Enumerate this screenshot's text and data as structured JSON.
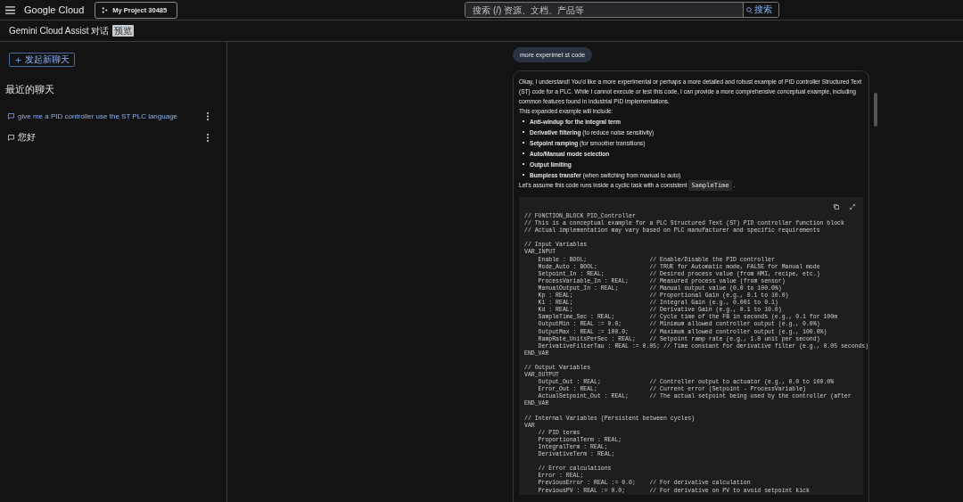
{
  "topbar": {
    "logo": "Google Cloud",
    "project": "My Project 30485",
    "search": {
      "placeholder": "搜索 (/) 资源、文档、产品等",
      "button": "搜索"
    }
  },
  "header": {
    "title": "Gemini Cloud Assist 对话",
    "badge": "预览"
  },
  "sidebar": {
    "new_chat": "发起新聊天",
    "heading": "最近的聊天",
    "chats": [
      {
        "label": "give me a PID controller use the ST PLC language",
        "selected": true
      },
      {
        "label": "您好",
        "selected": false
      }
    ]
  },
  "conversation": {
    "user_message": "more experimet st code",
    "response": {
      "intro": "Okay, I understand! You'd like a more experimental or perhaps a more detailed and robust example of PID controller Structured Text (ST) code for a PLC. While I cannot execute or test this code, I can provide a more comprehensive conceptual example, including common features found in industrial PID implementations.",
      "lead": "This expanded example will include:",
      "bullets": [
        {
          "term": "Anti-windup for the integral term"
        },
        {
          "term": "Derivative filtering",
          "note": "(to reduce noise sensitivity)"
        },
        {
          "term": "Setpoint ramping",
          "note": "(for smoother transitions)"
        },
        {
          "term": "Auto/Manual mode selection"
        },
        {
          "term": "Output limiting"
        },
        {
          "term": "Bumpless transfer",
          "note": "(when switching from manual to auto)"
        }
      ],
      "closing": {
        "before": "Let's assume this code runs inside a cyclic task with a consistent",
        "code": "SampleTime",
        "after": "."
      },
      "code_blocks": [
        [
          "// FUNCTION_BLOCK PID_Controller",
          "// This is a conceptual example for a PLC Structured Text (ST) PID controller function block",
          "// Actual implementation may vary based on PLC manufacturer and specific requirements"
        ],
        [
          "// Input Variables",
          "VAR_INPUT",
          "    Enable : BOOL;                  // Enable/Disable the PID controller",
          "    Mode_Auto : BOOL;               // TRUE for Automatic mode, FALSE for Manual mode",
          "    Setpoint_In : REAL;             // Desired process value (from HMI, recipe, etc.)",
          "    ProcessVariable_In : REAL;      // Measured process value (from sensor)",
          "    ManualOutput_In : REAL;         // Manual output value (0.0 to 100.0%)",
          "    Kp : REAL;                      // Proportional Gain (e.g., 0.1 to 10.0)",
          "    Ki : REAL;                      // Integral Gain (e.g., 0.001 to 0.1)",
          "    Kd : REAL;                      // Derivative Gain (e.g., 0.1 to 10.0)",
          "    SampleTime_Sec : REAL;          // Cycle time of the FB in seconds (e.g., 0.1 for 100m",
          "    OutputMin : REAL := 0.0;        // Minimum allowed controller output (e.g., 0.0%)",
          "    OutputMax : REAL := 100.0;      // Maximum allowed controller output (e.g., 100.0%)",
          "    RampRate_UnitsPerSec : REAL;    // Setpoint ramp rate (e.g., 1.0 unit per second)",
          "    DerivativeFilterTau : REAL := 0.05; // Time constant for derivative filter (e.g., 0.05 seconds)",
          "END_VAR"
        ],
        [
          "// Output Variables",
          "VAR_OUTPUT",
          "    Output_Out : REAL;              // Controller output to actuator (e.g., 0.0 to 100.0%",
          "    Error_Out : REAL;               // Current error (Setpoint - ProcessVariable)",
          "    ActualSetpoint_Out : REAL;      // The actual setpoint being used by the controller (after",
          "END_VAR"
        ],
        [
          "// Internal Variables (Persistent between cycles)",
          "VAR",
          "    // PID terms",
          "    ProportionalTerm : REAL;",
          "    IntegralTerm : REAL;",
          "    DerivativeTerm : REAL;"
        ],
        [
          "    // Error calculations",
          "    Error : REAL;",
          "    PreviousError : REAL := 0.0;    // For derivative calculation",
          "    PreviousPV : REAL := 0.0;       // For derivative on PV to avoid setpoint kick"
        ]
      ]
    }
  }
}
